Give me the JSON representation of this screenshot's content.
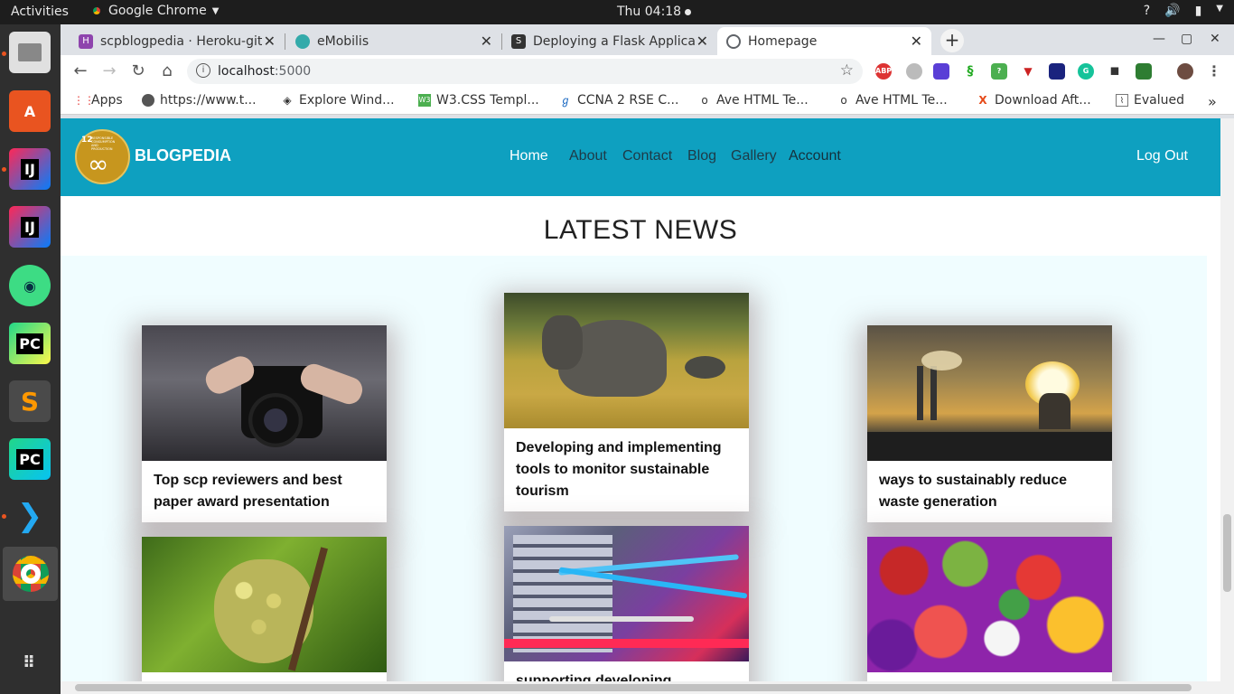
{
  "system_bar": {
    "activities": "Activities",
    "app_name": "Google Chrome",
    "clock": "Thu 04:18"
  },
  "browser": {
    "tabs": [
      {
        "title": "scpblogpedia · Heroku-git"
      },
      {
        "title": "eMobilis"
      },
      {
        "title": "Deploying a Flask Applica"
      },
      {
        "title": "Homepage"
      }
    ],
    "url_host": "localhost",
    "url_port": ":5000",
    "bookmarks": [
      {
        "label": "Apps"
      },
      {
        "label": "https://www.t..."
      },
      {
        "label": "Explore Wind..."
      },
      {
        "label": "W3.CSS Templ..."
      },
      {
        "label": "CCNA 2 RSE C..."
      },
      {
        "label": "Ave HTML Te..."
      },
      {
        "label": "Ave HTML Te..."
      },
      {
        "label": "Download Aft..."
      },
      {
        "label": "Evalued"
      }
    ]
  },
  "site": {
    "logo_number": "12",
    "logo_text": "RESPONSIBLE CONSUMPTION AND PRODUCTION",
    "brand": "BLOGPEDIA",
    "nav": [
      "Home",
      "About",
      "Contact",
      "Blog",
      "Gallery",
      "Account"
    ],
    "logout": "Log Out",
    "section_title": "LATEST NEWS",
    "cards": [
      {
        "caption": "Top scp reviewers and best paper award presentation",
        "image": "camera-photo"
      },
      {
        "caption": "Developing and implementing tools to monitor sustainable tourism",
        "image": "elephant-photo"
      },
      {
        "caption": "ways to sustainably reduce waste generation",
        "image": "power-plant-photo"
      },
      {
        "caption": "",
        "image": "grapes-photo"
      },
      {
        "caption": "supporting developing countries",
        "image": "server-cables-photo"
      },
      {
        "caption": "",
        "image": "fruits-photo"
      }
    ]
  }
}
